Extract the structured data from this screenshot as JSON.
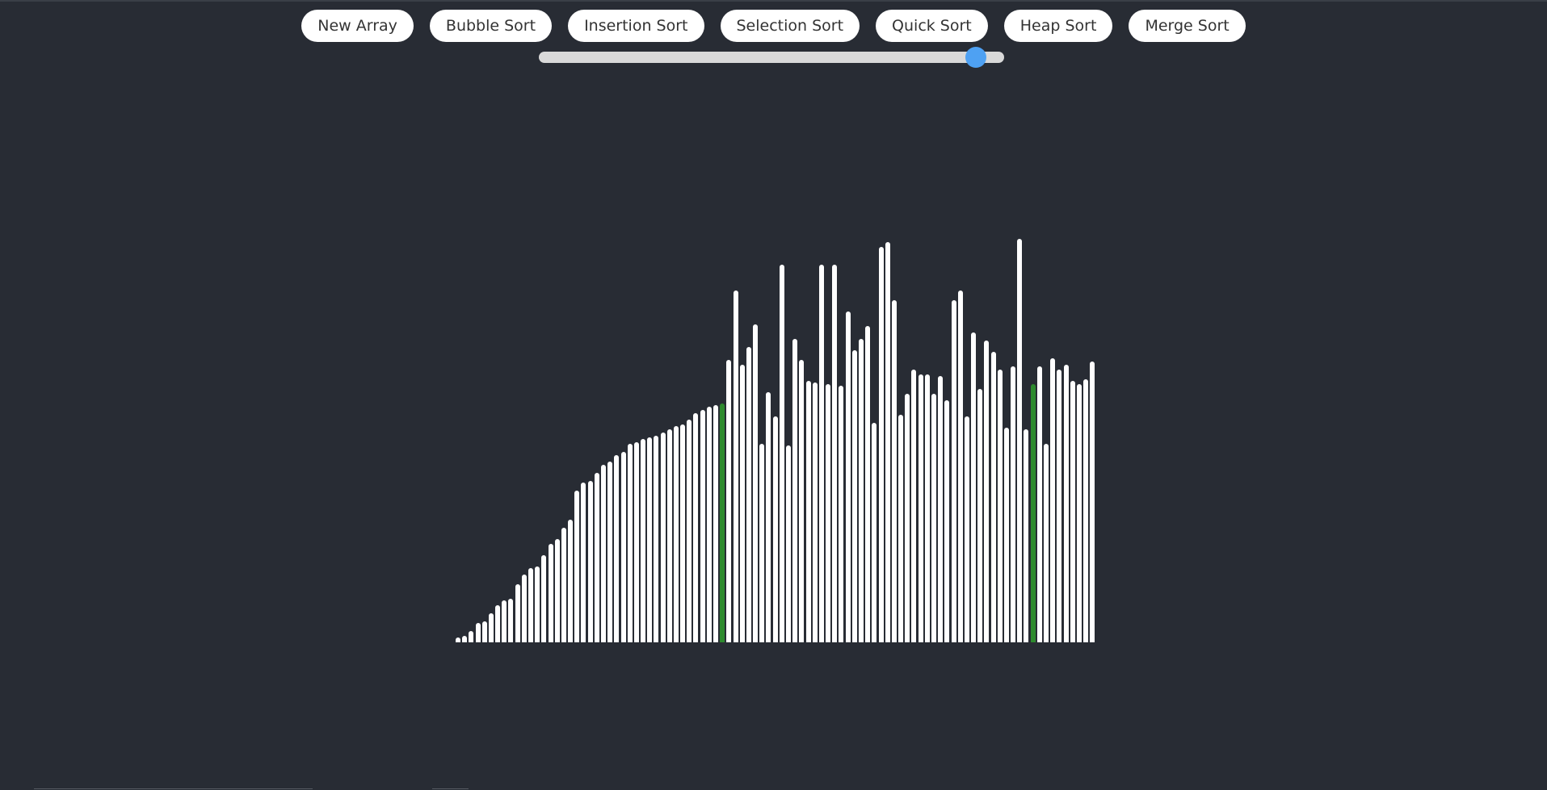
{
  "toolbar": {
    "buttons": [
      {
        "id": "new-array",
        "label": "New Array"
      },
      {
        "id": "bubble-sort",
        "label": "Bubble Sort"
      },
      {
        "id": "insertion-sort",
        "label": "Insertion Sort"
      },
      {
        "id": "selection-sort",
        "label": "Selection Sort"
      },
      {
        "id": "quick-sort",
        "label": "Quick Sort"
      },
      {
        "id": "heap-sort",
        "label": "Heap Sort"
      },
      {
        "id": "merge-sort",
        "label": "Merge Sort"
      }
    ]
  },
  "speed_slider": {
    "value_fraction": 0.94,
    "thumb_color": "#4ea1f3",
    "track_color": "#d9d9d9"
  },
  "colors": {
    "background": "#282c34",
    "bar": "#ffffff",
    "bar_highlight": "#2e8b2e"
  },
  "array": {
    "values": [
      3,
      4,
      7,
      12,
      13,
      18,
      23,
      26,
      27,
      36,
      42,
      46,
      47,
      54,
      61,
      64,
      71,
      76,
      94,
      99,
      100,
      105,
      110,
      112,
      116,
      118,
      123,
      124,
      126,
      127,
      128,
      130,
      132,
      134,
      135,
      138,
      142,
      144,
      146,
      147,
      148,
      175,
      218,
      172,
      183,
      197,
      123,
      155,
      140,
      234,
      122,
      188,
      175,
      162,
      161,
      234,
      160,
      234,
      159,
      205,
      181,
      188,
      196,
      136,
      245,
      248,
      212,
      141,
      154,
      169,
      166,
      166,
      154,
      165,
      150,
      212,
      218,
      140,
      192,
      157,
      187,
      180,
      169,
      133,
      171,
      250,
      132,
      160,
      171,
      123,
      176,
      169,
      172,
      162,
      160,
      163,
      174
    ],
    "highlight_indices": [
      40,
      87
    ]
  }
}
